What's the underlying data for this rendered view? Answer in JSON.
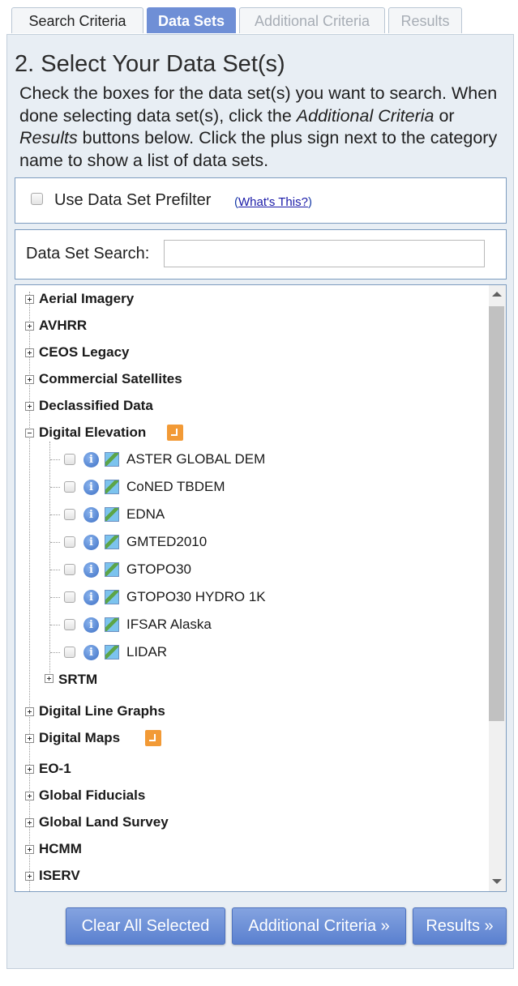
{
  "tabs": [
    {
      "label": "Search Criteria",
      "state": "normal"
    },
    {
      "label": "Data Sets",
      "state": "active"
    },
    {
      "label": "Additional Criteria",
      "state": "disabled"
    },
    {
      "label": "Results",
      "state": "disabled"
    }
  ],
  "heading": "2. Select Your Data Set(s)",
  "instructions": {
    "part1": "Check the boxes for the data set(s) you want to search. When done selecting data set(s), click the ",
    "em1": "Additional Criteria",
    "part2": " or ",
    "em2": "Results",
    "part3": " buttons below. Click the plus sign next to the category name to show a list of data sets."
  },
  "prefilter": {
    "label": "Use Data Set Prefilter",
    "help_open": "(",
    "help_link": "What's This?",
    "help_close": ")",
    "checked": false
  },
  "dataset_search": {
    "label": "Data Set Search:",
    "value": "",
    "placeholder": ""
  },
  "tree": {
    "categories_top": [
      {
        "label": "Aerial Imagery",
        "expanded": false
      },
      {
        "label": "AVHRR",
        "expanded": false
      },
      {
        "label": "CEOS Legacy",
        "expanded": false
      },
      {
        "label": "Commercial Satellites",
        "expanded": false
      },
      {
        "label": "Declassified Data",
        "expanded": false
      },
      {
        "label": "Digital Elevation",
        "expanded": true,
        "badge": "orange-flag-icon"
      }
    ],
    "digital_elevation_items": [
      {
        "label": "ASTER GLOBAL DEM",
        "checked": false
      },
      {
        "label": "CoNED TBDEM",
        "checked": false
      },
      {
        "label": "EDNA",
        "checked": false
      },
      {
        "label": "GMTED2010",
        "checked": false
      },
      {
        "label": "GTOPO30",
        "checked": false
      },
      {
        "label": "GTOPO30 HYDRO 1K",
        "checked": false
      },
      {
        "label": "IFSAR Alaska",
        "checked": false
      },
      {
        "label": "LIDAR",
        "checked": false
      }
    ],
    "subcategory": {
      "label": "SRTM",
      "expanded": false
    },
    "categories_bottom": [
      {
        "label": "Digital Line Graphs",
        "expanded": false
      },
      {
        "label": "Digital Maps",
        "expanded": false,
        "badge": "orange-flag-icon"
      },
      {
        "label": "EO-1",
        "expanded": false
      },
      {
        "label": "Global Fiducials",
        "expanded": false
      },
      {
        "label": "Global Land Survey",
        "expanded": false
      },
      {
        "label": "HCMM",
        "expanded": false
      },
      {
        "label": "ISERV",
        "expanded": false
      }
    ]
  },
  "buttons": {
    "clear": "Clear All Selected",
    "additional": "Additional Criteria »",
    "results": "Results »"
  },
  "colors": {
    "accent": "#6f8fd6",
    "panel_bg": "#e8eef4",
    "badge": "#f29a36"
  }
}
